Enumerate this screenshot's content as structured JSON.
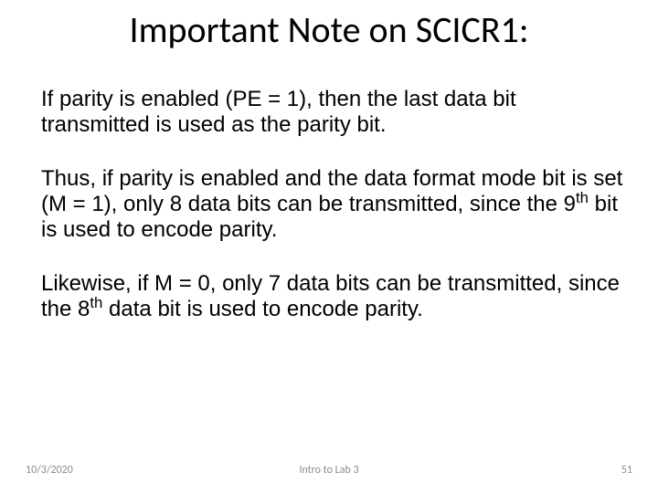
{
  "title": "Important Note on SCICR1:",
  "paragraphs": {
    "p1": "If parity is enabled (PE = 1), then the last data bit transmitted is used as the parity bit.",
    "p2a": "Thus, if parity is enabled and the data format mode bit is set (M = 1), only 8 data bits can be transmitted, since the 9",
    "p2sup": "th",
    "p2b": " bit is used to encode parity.",
    "p3a": "Likewise, if M = 0, only 7 data bits can be transmitted, since the 8",
    "p3sup": "th",
    "p3b": " data bit is used to encode parity."
  },
  "footer": {
    "date": "10/3/2020",
    "center": "Intro to Lab 3",
    "page": "51"
  }
}
